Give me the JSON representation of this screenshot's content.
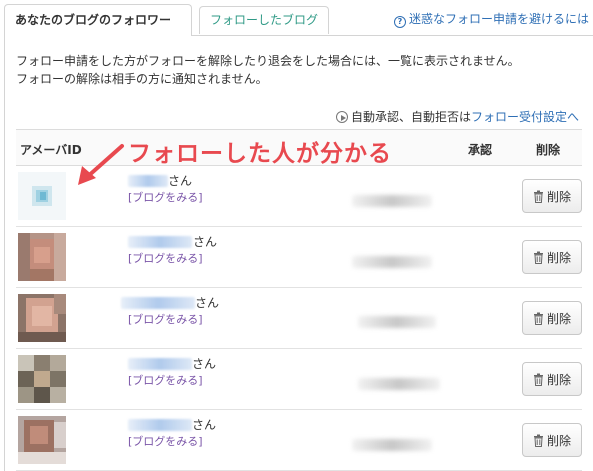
{
  "tabs": [
    {
      "label": "あなたのブログのフォロワー",
      "active": true
    },
    {
      "label": "フォローしたブログ",
      "active": false
    }
  ],
  "spam_link": {
    "icon": "info-icon",
    "label": "迷惑なフォロー申請を避けるには"
  },
  "notice": {
    "line1": "フォロー申請をした方がフォローを解除したり退会をした場合には、一覧に表示されません。",
    "line2": "フォローの解除は相手の方に通知されません。"
  },
  "settings_link": {
    "icon": "play-circle-icon",
    "prefix": "自動承認、自動拒否は",
    "link": "フォロー受付設定へ"
  },
  "table": {
    "headers": {
      "id": "アメーバID",
      "approve": "承認",
      "delete": "削除"
    },
    "rows": [
      {
        "suffix": "さん",
        "blog_link": "[ブログをみる]",
        "delete_label": "削除"
      },
      {
        "suffix": "さん",
        "blog_link": "[ブログをみる]",
        "delete_label": "削除"
      },
      {
        "suffix": "さん",
        "blog_link": "[ブログをみる]",
        "delete_label": "削除"
      },
      {
        "suffix": "さん",
        "blog_link": "[ブログをみる]",
        "delete_label": "削除"
      },
      {
        "suffix": "さん",
        "blog_link": "[ブログをみる]",
        "delete_label": "削除"
      }
    ]
  },
  "annotation": {
    "text": "フォローした人が分かる"
  },
  "colors": {
    "annotation": "#e8494f",
    "link_blue": "#2f6fb5",
    "link_purple": "#7a55a8",
    "tab_inactive": "#2f9a86"
  }
}
